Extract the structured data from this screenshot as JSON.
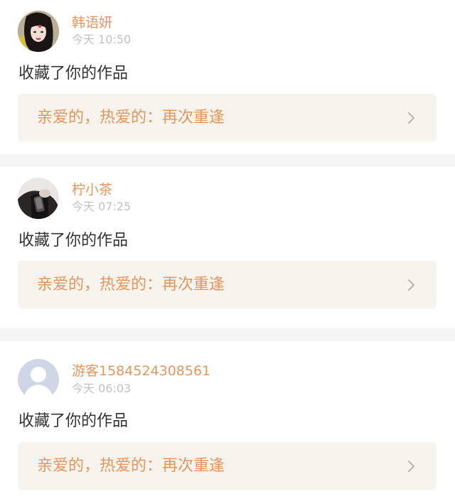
{
  "notifications": [
    {
      "username": "韩语妍",
      "timestamp": "今天 10:50",
      "action": "收藏了你的作品",
      "work_title": "亲爱的，热爱的：再次重逢",
      "avatar": "user-avatar-photo"
    },
    {
      "username": "柠小茶",
      "timestamp": "今天 07:25",
      "action": "收藏了你的作品",
      "work_title": "亲爱的，热爱的：再次重逢",
      "avatar": "user-avatar-photo"
    },
    {
      "username": "游客1584524308561",
      "timestamp": "今天 06:03",
      "action": "收藏了你的作品",
      "work_title": "亲爱的，热爱的：再次重逢",
      "avatar": "default-guest-avatar"
    }
  ],
  "colors": {
    "accent": "#e8955c",
    "timestamp": "#c2c2c2",
    "body_text": "#333333",
    "link_bg": "#f6f4ec",
    "separator": "#f5f5f5",
    "chevron": "#b5b5b5"
  },
  "icons": {
    "chevron": "chevron-right-icon"
  }
}
